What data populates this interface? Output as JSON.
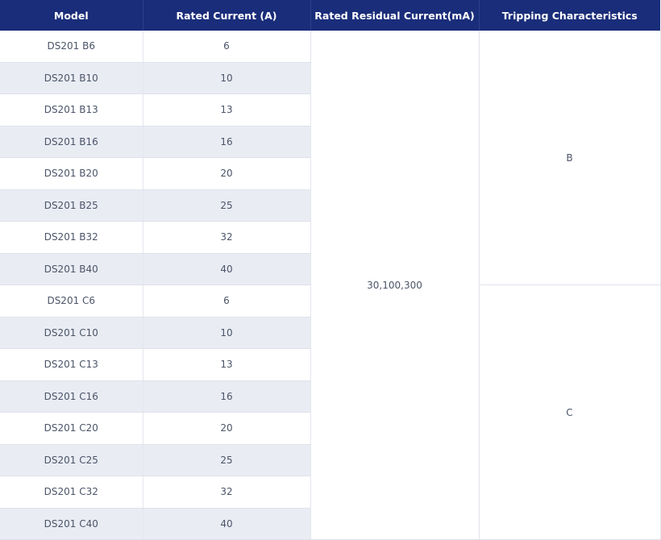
{
  "header": {
    "model": "Model",
    "rated_current": "Rated Current (A)",
    "rated_residual_current": "Rated Residual Current(mA)",
    "tripping_characteristics": "Tripping Characteristics"
  },
  "rows": [
    {
      "model": "DS201 B6",
      "current": "6"
    },
    {
      "model": "DS201 B10",
      "current": "10"
    },
    {
      "model": "DS201 B13",
      "current": "13"
    },
    {
      "model": "DS201 B16",
      "current": "16"
    },
    {
      "model": "DS201 B20",
      "current": "20"
    },
    {
      "model": "DS201 B25",
      "current": "25"
    },
    {
      "model": "DS201 B32",
      "current": "32"
    },
    {
      "model": "DS201 B40",
      "current": "40"
    },
    {
      "model": "DS201 C6",
      "current": "6"
    },
    {
      "model": "DS201 C10",
      "current": "10"
    },
    {
      "model": "DS201 C13",
      "current": "13"
    },
    {
      "model": "DS201 C16",
      "current": "16"
    },
    {
      "model": "DS201 C20",
      "current": "20"
    },
    {
      "model": "DS201 C25",
      "current": "25"
    },
    {
      "model": "DS201 C32",
      "current": "32"
    },
    {
      "model": "DS201 C40",
      "current": "40"
    }
  ],
  "residual_current": "30,100,300",
  "tripping": {
    "group_b": "B",
    "group_c": "C"
  },
  "colors": {
    "header_bg": "#1a2d7a",
    "alt_row_bg": "#e9ecf3",
    "text": "#4b5468"
  }
}
